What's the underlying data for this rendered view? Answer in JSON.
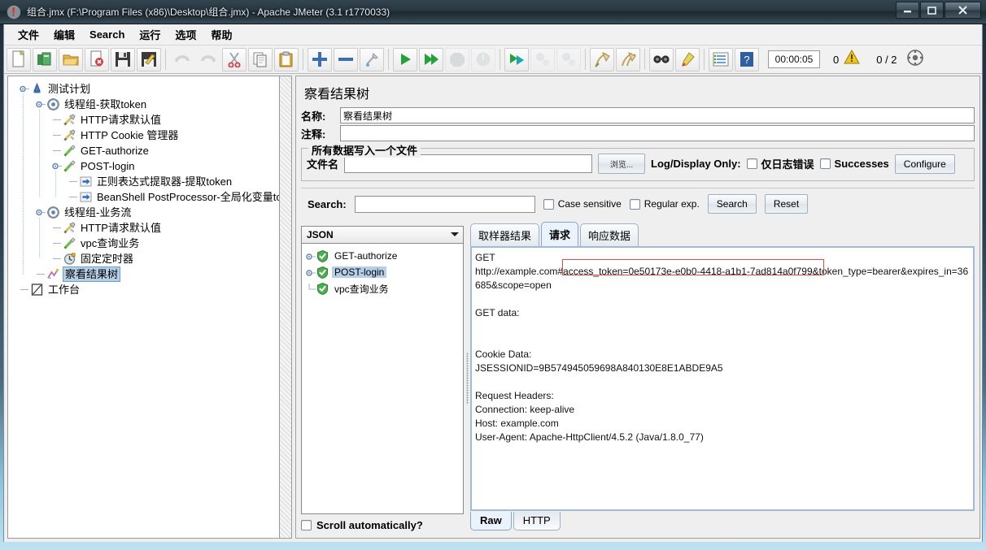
{
  "window": {
    "title": "组合.jmx (F:\\Program Files (x86)\\Desktop\\组合.jmx) - Apache JMeter (3.1 r1770033)",
    "minimize_label": "–",
    "maximize_label": "□",
    "close_label": "✕"
  },
  "menu": {
    "items": [
      {
        "label": "文件"
      },
      {
        "label": "编辑"
      },
      {
        "label": "Search"
      },
      {
        "label": "运行"
      },
      {
        "label": "选项"
      },
      {
        "label": "帮助"
      }
    ]
  },
  "toolbar": {
    "icons": [
      "new-icon",
      "templates-icon",
      "open-icon",
      "close-icon",
      "save-icon",
      "save-as-icon",
      "undo-icon",
      "redo-icon",
      "cut-icon",
      "copy-icon",
      "paste-icon",
      "expand-icon",
      "collapse-icon",
      "toggle-icon",
      "start-icon",
      "start-no-pause-icon",
      "stop-icon",
      "shutdown-icon",
      "remote-start-icon",
      "remote-stop-icon",
      "remote-shutdown-icon",
      "clear-icon",
      "clear-all-icon",
      "search-icon",
      "reset-search-icon",
      "function-helper-icon",
      "help-icon"
    ],
    "timer": "00:00:05",
    "warning_count": "0",
    "thread_count": "0 / 2"
  },
  "tree": {
    "nodes": [
      {
        "label": "测试计划",
        "icon": "test-plan-icon",
        "depth": 0,
        "expandable": true,
        "selected": false
      },
      {
        "label": "线程组-获取token",
        "icon": "thread-group-icon",
        "depth": 1,
        "expandable": true,
        "selected": false
      },
      {
        "label": "HTTP请求默认值",
        "icon": "config-element-icon",
        "depth": 2,
        "expandable": false,
        "selected": false
      },
      {
        "label": "HTTP Cookie 管理器",
        "icon": "config-element-icon",
        "depth": 2,
        "expandable": false,
        "selected": false
      },
      {
        "label": "GET-authorize",
        "icon": "http-sampler-icon",
        "depth": 2,
        "expandable": false,
        "selected": false
      },
      {
        "label": "POST-login",
        "icon": "http-sampler-icon",
        "depth": 2,
        "expandable": true,
        "selected": false
      },
      {
        "label": "正则表达式提取器-提取token",
        "icon": "post-processor-icon",
        "depth": 3,
        "expandable": false,
        "selected": false
      },
      {
        "label": "BeanShell PostProcessor-全局化变量token",
        "icon": "post-processor-icon",
        "depth": 3,
        "expandable": false,
        "selected": false
      },
      {
        "label": "线程组-业务流",
        "icon": "thread-group-icon",
        "depth": 1,
        "expandable": true,
        "selected": false
      },
      {
        "label": "HTTP请求默认值",
        "icon": "config-element-icon",
        "depth": 2,
        "expandable": false,
        "selected": false
      },
      {
        "label": "vpc查询业务",
        "icon": "http-sampler-icon",
        "depth": 2,
        "expandable": false,
        "selected": false
      },
      {
        "label": "固定定时器",
        "icon": "timer-icon",
        "depth": 2,
        "expandable": false,
        "selected": false
      },
      {
        "label": "察看结果树",
        "icon": "view-results-tree-icon",
        "depth": 1,
        "expandable": false,
        "selected": true
      },
      {
        "label": "工作台",
        "icon": "workbench-icon",
        "depth": 0,
        "expandable": false,
        "selected": false
      }
    ]
  },
  "panel": {
    "title": "察看结果树",
    "name_label": "名称:",
    "name_value": "察看结果树",
    "comment_label": "注释:",
    "comment_value": "",
    "file_group": {
      "title": "所有数据写入一个文件",
      "filename_label": "文件名",
      "filename_value": "",
      "browse_label": "浏览...",
      "logdisplay_label": "Log/Display Only:",
      "errors_label": "仅日志错误",
      "successes_label": "Successes",
      "configure_label": "Configure"
    },
    "search": {
      "label": "Search:",
      "value": "",
      "case_sensitive_label": "Case sensitive",
      "regular_exp_label": "Regular exp.",
      "search_button": "Search",
      "reset_button": "Reset"
    }
  },
  "results": {
    "renderer_selected": "JSON",
    "items": [
      {
        "label": "GET-authorize",
        "status": "success",
        "expandable": true,
        "selected": false
      },
      {
        "label": "POST-login",
        "status": "success",
        "expandable": true,
        "selected": true
      },
      {
        "label": "vpc查询业务",
        "status": "success",
        "expandable": false,
        "selected": false
      }
    ],
    "scroll_automatically_label": "Scroll automatically?"
  },
  "detail": {
    "tabs": [
      {
        "label": "取样器结果",
        "active": false
      },
      {
        "label": "请求",
        "active": true
      },
      {
        "label": "响应数据",
        "active": false
      }
    ],
    "request_text": "GET\nhttp://example.com#access_token=0e50173e-e0b0-4418-a1b1-7ad814a0f799&token_type=bearer&expires_in=36685&scope=open\n\nGET data:\n\n\nCookie Data:\nJSESSIONID=9B574945059698A840130E8E1ABDE9A5\n\nRequest Headers:\nConnection: keep-alive\nHost: example.com\nUser-Agent: Apache-HttpClient/4.5.2 (Java/1.8.0_77)",
    "highlight_text": "access_token=0e50173e-e0b0-4418-a1b1-7ad814a0f799",
    "bottom_tabs": [
      {
        "label": "Raw",
        "active": true
      },
      {
        "label": "HTTP",
        "active": false
      }
    ]
  },
  "colors": {
    "highlight_border": "#e04a4a",
    "selection": "#b5cfe7",
    "success": "#3cb043",
    "accent_border": "#9fbbd6"
  }
}
